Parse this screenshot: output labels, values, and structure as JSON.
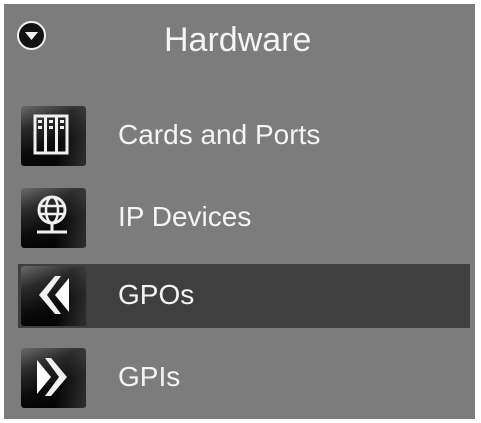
{
  "header": {
    "title": "Hardware",
    "toggle_icon": "chevron-down-circle-icon"
  },
  "nav": {
    "items": [
      {
        "label": "Cards and Ports",
        "icon": "cards-ports-icon",
        "selected": false
      },
      {
        "label": "IP Devices",
        "icon": "globe-network-icon",
        "selected": false
      },
      {
        "label": "GPOs",
        "icon": "gpo-arrow-icon",
        "selected": true
      },
      {
        "label": "GPIs",
        "icon": "gpi-arrow-icon",
        "selected": false
      }
    ]
  },
  "colors": {
    "panel_background": "#7c7c7c",
    "selected_background": "#3f3f3f",
    "text": "#f4f4f4"
  }
}
